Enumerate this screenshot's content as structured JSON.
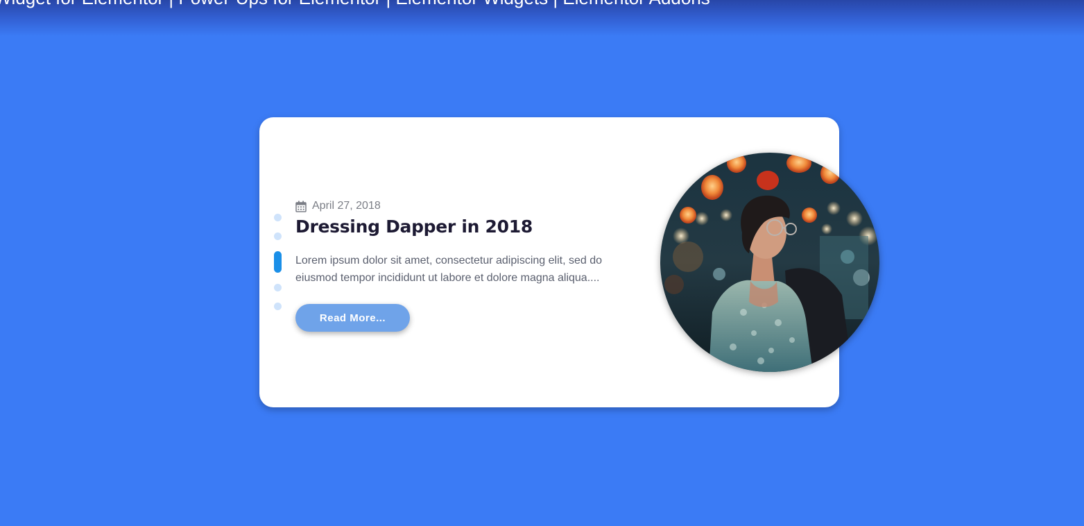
{
  "banner": {
    "text": "Widget for Elementor | Power-Ups for Elementor | Elementor Widgets | Elementor Addons"
  },
  "colors": {
    "background": "#3b7bf5",
    "card": "#ffffff",
    "accent": "#1a8fe8",
    "button": "#6fa3e9",
    "title": "#1d1a33"
  },
  "slider": {
    "dot_count": 5,
    "active_index": 2
  },
  "post": {
    "icon": "calendar-icon",
    "date": "April 27, 2018",
    "title": "Dressing Dapper in 2018",
    "excerpt": "Lorem ipsum dolor sit amet, consectetur adipiscing elit, sed do eiusmod tempor incididunt ut labore et dolore magna aliqua....",
    "read_more_label": "Read More...",
    "image_alt": "Woman in lace dress under lanterns at night"
  }
}
